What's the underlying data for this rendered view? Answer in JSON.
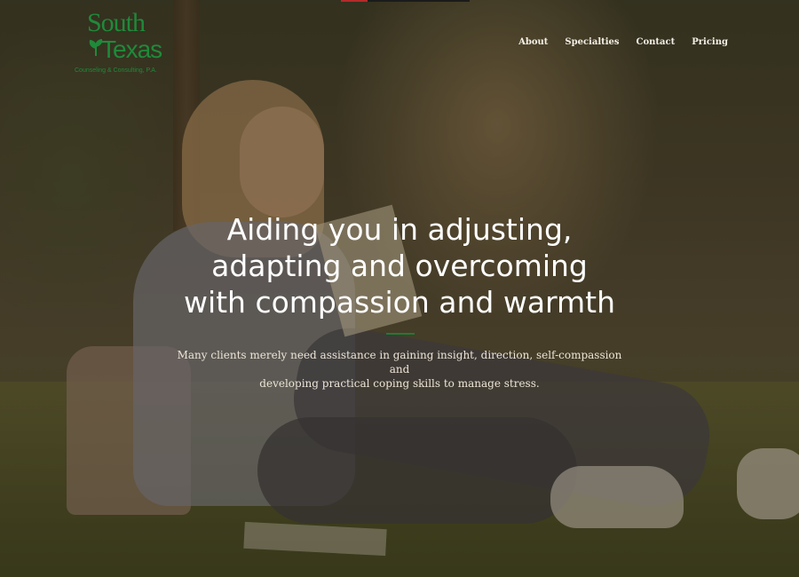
{
  "logo": {
    "line1": "South",
    "line2": "Texas",
    "tagline": "Counseling & Consulting, P.A."
  },
  "nav": {
    "items": [
      {
        "label": "About"
      },
      {
        "label": "Specialties"
      },
      {
        "label": "Contact"
      },
      {
        "label": "Pricing"
      }
    ]
  },
  "hero": {
    "headline_line1": "Aiding you in adjusting,",
    "headline_line2": "adapting and overcoming",
    "headline_line3": "with compassion and warmth",
    "subtext_line1": "Many clients merely need assistance in gaining insight, direction, self-compassion and",
    "subtext_line2": "developing practical coping skills to manage stress."
  },
  "colors": {
    "brand_green": "#1f8a3a",
    "accent_red": "#b52a2a"
  }
}
